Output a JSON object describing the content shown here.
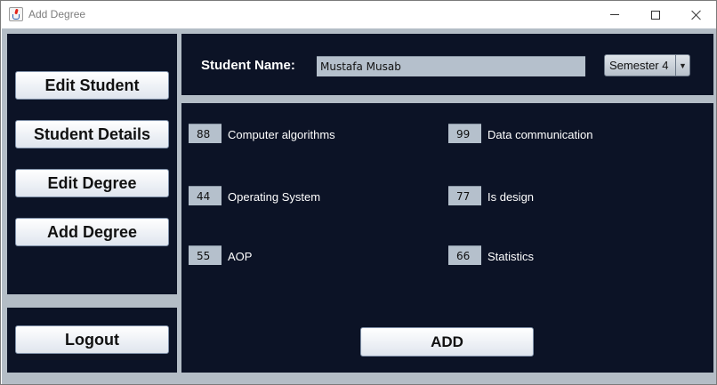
{
  "window": {
    "title": "Add Degree"
  },
  "sidebar": {
    "items": [
      {
        "label": "Edit Student"
      },
      {
        "label": "Student Details"
      },
      {
        "label": "Edit Degree"
      },
      {
        "label": "Add Degree"
      }
    ],
    "logout_label": "Logout"
  },
  "header": {
    "student_name_label": "Student Name:",
    "student_name_value": "Mustafa Musab",
    "semester_selected": "Semester 4"
  },
  "courses": [
    {
      "grade": "88",
      "name": "Computer algorithms"
    },
    {
      "grade": "99",
      "name": "Data communication"
    },
    {
      "grade": "44",
      "name": "Operating System"
    },
    {
      "grade": "77",
      "name": "Is design"
    },
    {
      "grade": "55",
      "name": "AOP"
    },
    {
      "grade": "66",
      "name": "Statistics"
    }
  ],
  "actions": {
    "add_label": "ADD"
  },
  "colors": {
    "panel_background": "#0c1326",
    "content_background": "#b4bdc6",
    "field_background": "#b5c0cc"
  },
  "icons": {
    "app": "java-cup-icon",
    "minimize": "minimize-icon",
    "maximize": "maximize-icon",
    "close": "close-icon",
    "dropdown": "chevron-down-icon"
  }
}
